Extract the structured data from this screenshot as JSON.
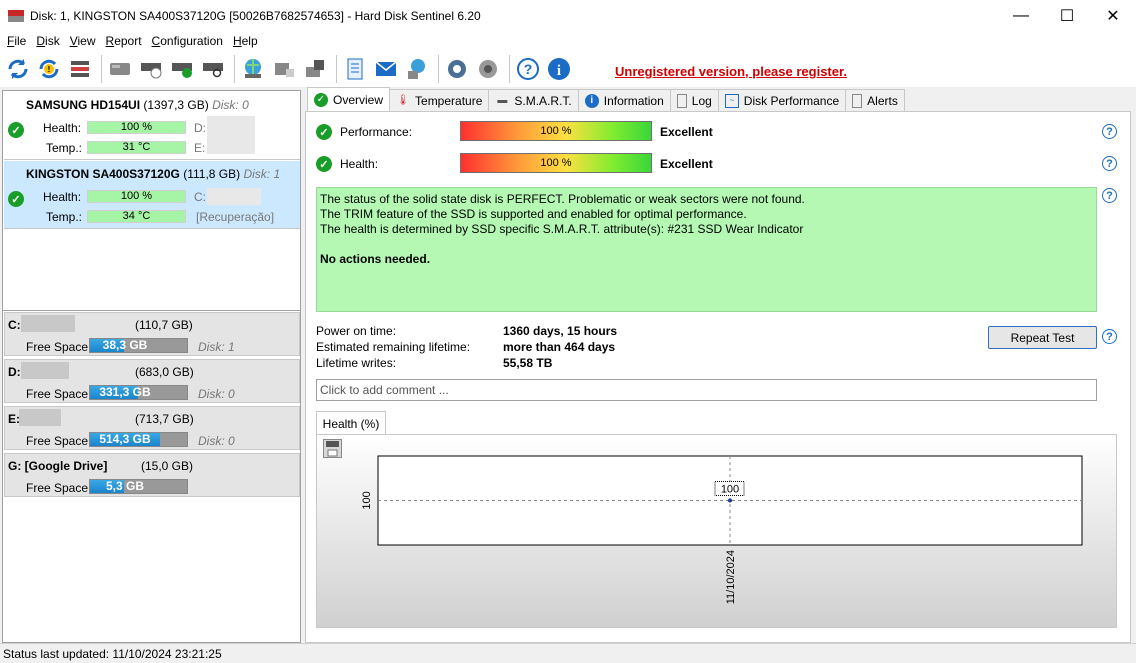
{
  "window": {
    "title": "Disk: 1, KINGSTON SA400S37120G [50026B7682574653]  -  Hard Disk Sentinel 6.20",
    "minimize": "—",
    "maximize": "☐",
    "close": "✕"
  },
  "menu": [
    "File",
    "Disk",
    "View",
    "Report",
    "Configuration",
    "Help"
  ],
  "toolbar": {
    "register_text": "Unregistered version, please register."
  },
  "disks": [
    {
      "name": "SAMSUNG HD154UI",
      "size": "(1397,3 GB)",
      "disk": "Disk: 0",
      "health_label": "Health:",
      "health_value": "100 %",
      "health_fraction": 1.0,
      "temp_label": "Temp.:",
      "temp_value": "31 °C",
      "drive1": "D:",
      "drive2": "E:"
    },
    {
      "name": "KINGSTON SA400S37120G",
      "size": "(111,8 GB)",
      "disk": "Disk: 1",
      "health_label": "Health:",
      "health_value": "100 %",
      "health_fraction": 1.0,
      "temp_label": "Temp.:",
      "temp_value": "34 °C",
      "drive1": "C:",
      "drive2": "[Recuperação]"
    }
  ],
  "volumes": [
    {
      "letter": "C:",
      "size": "(110,7 GB)",
      "free_label": "Free Space",
      "free_value": "38,3 GB",
      "free_fraction": 0.35,
      "disk": "Disk: 1"
    },
    {
      "letter": "D:",
      "size": "(683,0 GB)",
      "free_label": "Free Space",
      "free_value": "331,3 GB",
      "free_fraction": 0.49,
      "disk": "Disk: 0"
    },
    {
      "letter": "E:",
      "size": "(713,7 GB)",
      "free_label": "Free Space",
      "free_value": "514,3 GB",
      "free_fraction": 0.72,
      "disk": "Disk: 0"
    },
    {
      "letter": "G: [Google Drive]",
      "size": "(15,0 GB)",
      "free_label": "Free Space",
      "free_value": "5,3 GB",
      "free_fraction": 0.35,
      "disk": ""
    }
  ],
  "tabs": [
    "Overview",
    "Temperature",
    "S.M.A.R.T.",
    "Information",
    "Log",
    "Disk Performance",
    "Alerts"
  ],
  "overview": {
    "performance_label": "Performance:",
    "performance_value": "100 %",
    "performance_rating": "Excellent",
    "health_label": "Health:",
    "health_value": "100 %",
    "health_rating": "Excellent",
    "status_lines": [
      "The status of the solid state disk is PERFECT. Problematic or weak sectors were not found.",
      "The TRIM feature of the SSD is supported and enabled for optimal performance.",
      "The health is determined by SSD specific S.M.A.R.T. attribute(s):  #231 SSD Wear Indicator"
    ],
    "status_action": "No actions needed.",
    "power_on_label": "Power on time:",
    "power_on_value": "1360 days, 15 hours",
    "remaining_label": "Estimated remaining lifetime:",
    "remaining_value": "more than 464 days",
    "writes_label": "Lifetime writes:",
    "writes_value": "55,58 TB",
    "repeat_button": "Repeat Test",
    "comment_placeholder": "Click to add comment ..."
  },
  "chart_tab": "Health (%)",
  "chart_data": {
    "type": "line",
    "x": [
      "11/10/2024"
    ],
    "series": [
      {
        "values": [
          100
        ]
      }
    ],
    "ytick": "100",
    "xtick": "11/10/2024",
    "point_label": "100"
  },
  "status": "Status last updated: 11/10/2024 23:21:25"
}
